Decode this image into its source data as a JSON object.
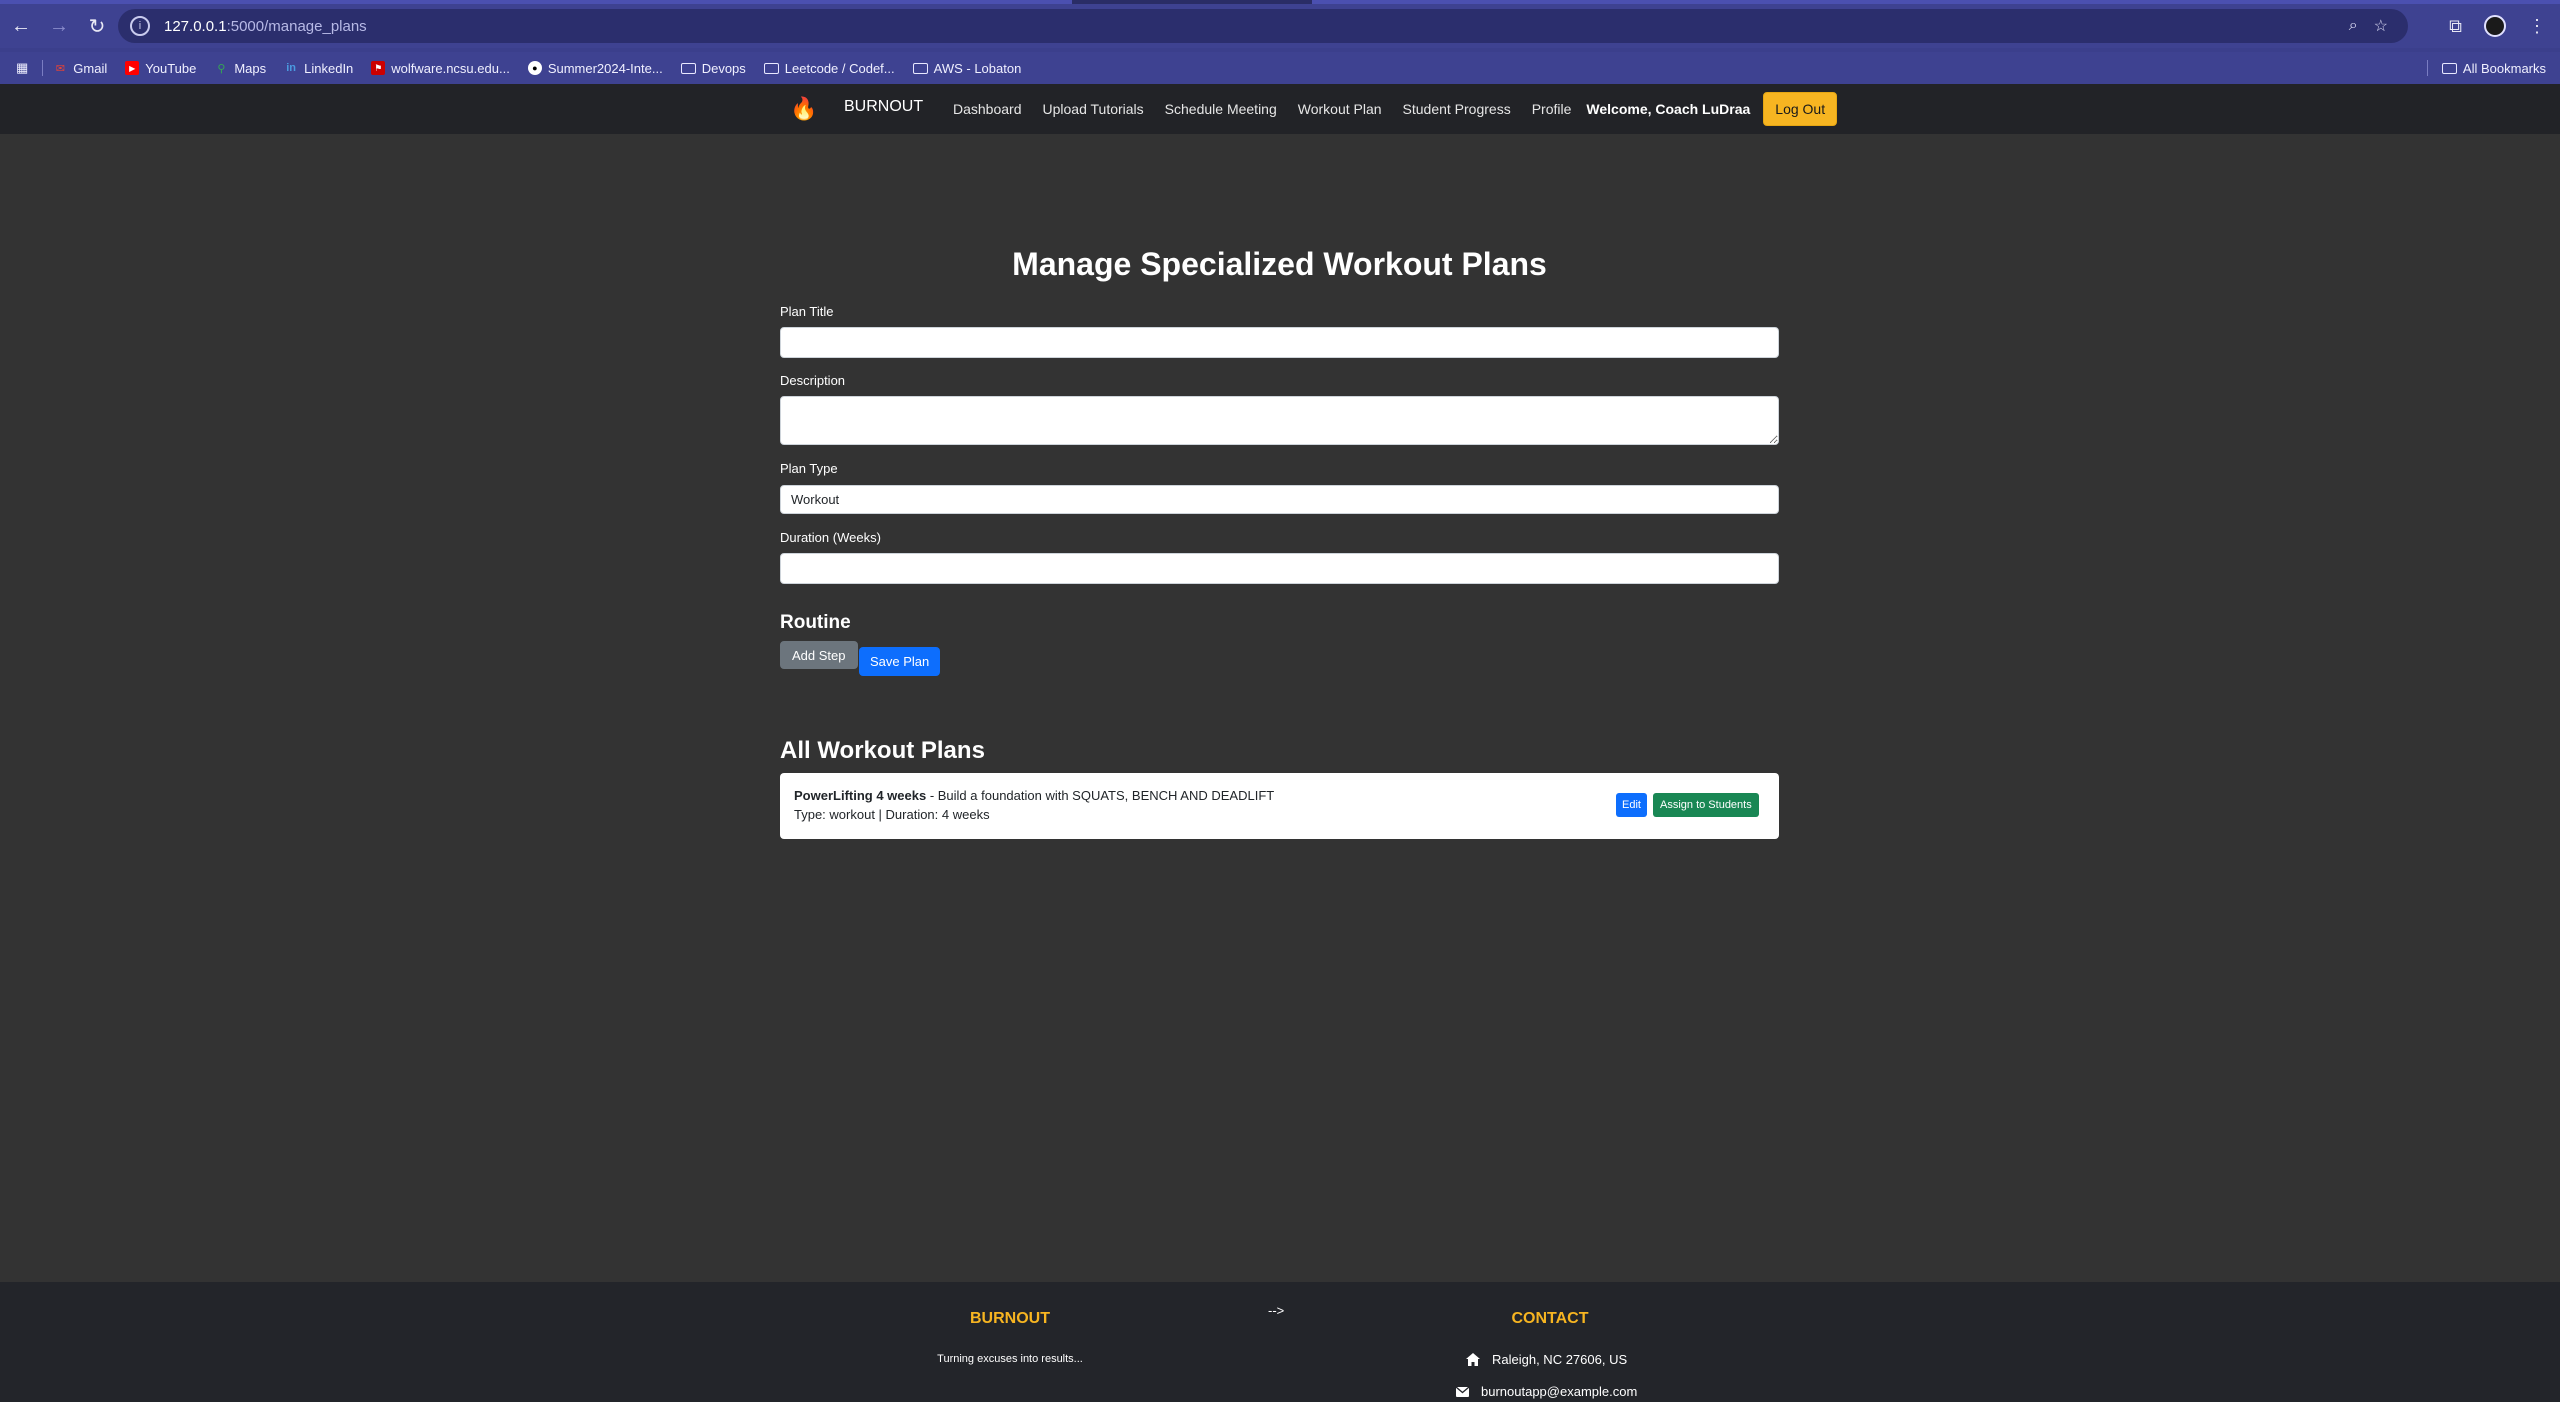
{
  "browser": {
    "url_host": "127.0.0.1",
    "url_path": ":5000/manage_plans",
    "bookmarks": [
      {
        "label": "Gmail",
        "icon": "gmail-icon",
        "color": "#ea4335"
      },
      {
        "label": "YouTube",
        "icon": "youtube-icon",
        "color": "#ff0000"
      },
      {
        "label": "Maps",
        "icon": "maps-icon",
        "color": "#34a853"
      },
      {
        "label": "LinkedIn",
        "icon": "linkedin-icon",
        "color": "#0a66c2"
      },
      {
        "label": "wolfware.ncsu.edu...",
        "icon": "ncsu-icon",
        "color": "#cc0000"
      },
      {
        "label": "Summer2024-Inte...",
        "icon": "github-icon",
        "color": "#ffffff"
      },
      {
        "label": "Devops",
        "icon": "folder-icon",
        "color": "#ffffff"
      },
      {
        "label": "Leetcode / Codef...",
        "icon": "folder-icon",
        "color": "#ffffff"
      },
      {
        "label": "AWS - Lobaton",
        "icon": "folder-icon",
        "color": "#ffffff"
      }
    ],
    "all_bookmarks": "All Bookmarks"
  },
  "navbar": {
    "brand": "BURNOUT",
    "links": [
      "Dashboard",
      "Upload Tutorials",
      "Schedule Meeting",
      "Workout Plan",
      "Student Progress",
      "Profile"
    ],
    "welcome": "Welcome, Coach LuDraa",
    "logout": "Log Out"
  },
  "form": {
    "title": "Manage Specialized Workout Plans",
    "plan_title_label": "Plan Title",
    "plan_title_value": "",
    "description_label": "Description",
    "description_value": "",
    "plan_type_label": "Plan Type",
    "plan_type_value": "Workout",
    "duration_label": "Duration (Weeks)",
    "duration_value": "",
    "routine_heading": "Routine",
    "add_step": "Add Step",
    "save_plan": "Save Plan"
  },
  "plans": {
    "heading": "All Workout Plans",
    "items": [
      {
        "name": "PowerLifting 4 weeks",
        "description": " - Build a foundation with SQUATS, BENCH AND DEADLIFT",
        "meta": "Type: workout | Duration: 4 weeks",
        "edit": "Edit",
        "assign": "Assign to Students"
      }
    ]
  },
  "footer": {
    "brand": "BURNOUT",
    "tagline": "Turning excuses into results...",
    "stray_text": "-->",
    "contact_heading": "CONTACT",
    "address": "Raleigh, NC 27606, US",
    "email": "burnoutapp@example.com"
  },
  "colors": {
    "accent": "#f7b521",
    "primary": "#0d6efd",
    "success": "#198754",
    "secondary": "#6c757d",
    "page_bg": "#333333",
    "nav_bg": "#222327"
  }
}
